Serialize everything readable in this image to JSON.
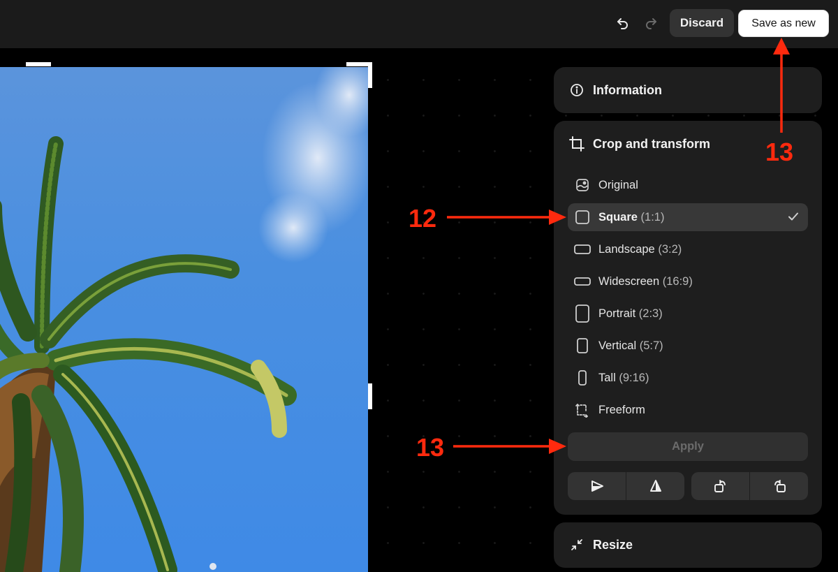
{
  "toolbar": {
    "undo_icon": "undo-icon",
    "redo_icon": "redo-icon",
    "discard_label": "Discard",
    "save_label": "Save as new"
  },
  "canvas": {
    "image_description": "Palm tree against blue sky with a cloud and daytime moon"
  },
  "panels": {
    "information": {
      "title": "Information",
      "icon": "info-icon"
    },
    "crop": {
      "title": "Crop and transform",
      "icon": "crop-icon",
      "ratios": [
        {
          "label": "Original",
          "ratio": "",
          "icon": "image-icon",
          "selected": false
        },
        {
          "label": "Square",
          "ratio": "(1:1)",
          "icon": "square-icon",
          "selected": true
        },
        {
          "label": "Landscape",
          "ratio": "(3:2)",
          "icon": "landscape-icon",
          "selected": false
        },
        {
          "label": "Widescreen",
          "ratio": "(16:9)",
          "icon": "widescreen-icon",
          "selected": false
        },
        {
          "label": "Portrait",
          "ratio": "(2:3)",
          "icon": "portrait-icon",
          "selected": false
        },
        {
          "label": "Vertical",
          "ratio": "(5:7)",
          "icon": "vertical-icon",
          "selected": false
        },
        {
          "label": "Tall",
          "ratio": "(9:16)",
          "icon": "tall-icon",
          "selected": false
        },
        {
          "label": "Freeform",
          "ratio": "",
          "icon": "freeform-icon",
          "selected": false
        }
      ],
      "apply_label": "Apply",
      "transform_buttons": [
        "flip-horizontal",
        "flip-vertical",
        "rotate-left",
        "rotate-right"
      ]
    },
    "resize": {
      "title": "Resize",
      "icon": "resize-icon"
    }
  },
  "annotations": {
    "square": "12",
    "apply": "13",
    "save": "13",
    "color": "#ff2a0e"
  }
}
